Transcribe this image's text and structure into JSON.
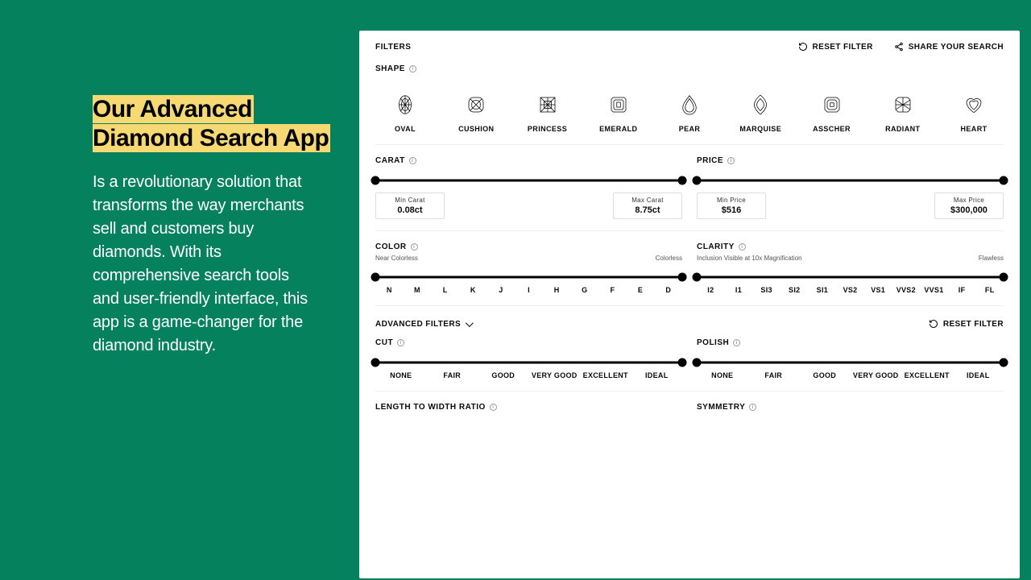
{
  "promo": {
    "title_line1": "Our Advanced",
    "title_line2": "Diamond Search App",
    "body": "Is a revolutionary solution that transforms the way merchants sell and customers buy diamonds. With its comprehensive search tools and user-friendly interface, this app is a game-changer for the diamond industry."
  },
  "header": {
    "filters": "FILTERS",
    "reset": "RESET FILTER",
    "share": "SHARE YOUR SEARCH"
  },
  "shape_section": {
    "title": "SHAPE",
    "shapes": [
      "OVAL",
      "CUSHION",
      "PRINCESS",
      "EMERALD",
      "PEAR",
      "MARQUISE",
      "ASSCHER",
      "RADIANT",
      "HEART"
    ]
  },
  "carat": {
    "title": "CARAT",
    "min_label": "Min Carat",
    "min_value": "0.08ct",
    "max_label": "Max Carat",
    "max_value": "8.75ct"
  },
  "price": {
    "title": "PRICE",
    "min_label": "Min Price",
    "min_value": "$516",
    "max_label": "Max Price",
    "max_value": "$300,000"
  },
  "color": {
    "title": "COLOR",
    "hint_low": "Near Colorless",
    "hint_high": "Colorless",
    "ticks": [
      "N",
      "M",
      "L",
      "K",
      "J",
      "I",
      "H",
      "G",
      "F",
      "E",
      "D"
    ]
  },
  "clarity": {
    "title": "CLARITY",
    "hint_low": "Inclusion Visible at 10x Magnification",
    "hint_high": "Flawless",
    "ticks": [
      "I2",
      "I1",
      "SI3",
      "SI2",
      "SI1",
      "VS2",
      "VS1",
      "VVS2",
      "VVS1",
      "IF",
      "FL"
    ]
  },
  "advanced": {
    "title": "ADVANCED FILTERS",
    "reset": "RESET FILTER"
  },
  "cut": {
    "title": "CUT",
    "ticks": [
      "NONE",
      "FAIR",
      "GOOD",
      "VERY GOOD",
      "EXCELLENT",
      "IDEAL"
    ]
  },
  "polish": {
    "title": "POLISH",
    "ticks": [
      "NONE",
      "FAIR",
      "GOOD",
      "VERY GOOD",
      "EXCELLENT",
      "IDEAL"
    ]
  },
  "lw": {
    "title": "LENGTH TO WIDTH RATIO"
  },
  "symmetry": {
    "title": "SYMMETRY"
  }
}
